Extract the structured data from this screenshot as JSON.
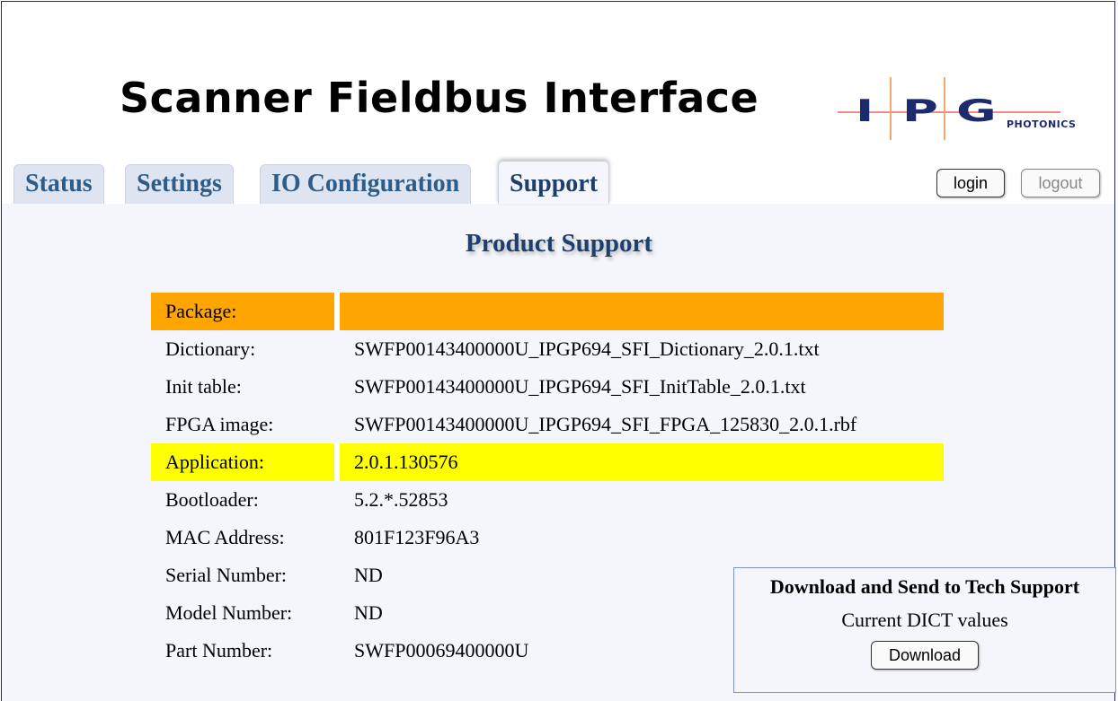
{
  "header": {
    "title": "Scanner Fieldbus Interface",
    "logo": {
      "letters": [
        "I",
        "P",
        "G"
      ],
      "subtext": "PHOTONICS"
    }
  },
  "tabs": [
    {
      "label": "Status"
    },
    {
      "label": "Settings"
    },
    {
      "label": "IO Configuration"
    },
    {
      "label": "Support",
      "active": true
    }
  ],
  "auth": {
    "login_label": "login",
    "logout_label": "logout",
    "logout_disabled": true
  },
  "page": {
    "title": "Product Support"
  },
  "info_rows": [
    {
      "label": "Package:",
      "value": "",
      "highlight": "orange"
    },
    {
      "label": "Dictionary:",
      "value": "SWFP00143400000U_IPGP694_SFI_Dictionary_2.0.1.txt"
    },
    {
      "label": "Init table:",
      "value": "SWFP00143400000U_IPGP694_SFI_InitTable_2.0.1.txt"
    },
    {
      "label": "FPGA image:",
      "value": "SWFP00143400000U_IPGP694_SFI_FPGA_125830_2.0.1.rbf"
    },
    {
      "label": "Application:",
      "value": "2.0.1.130576",
      "highlight": "yellow"
    },
    {
      "label": "Bootloader:",
      "value": "5.2.*.52853"
    },
    {
      "label": "MAC Address:",
      "value": "801F123F96A3"
    },
    {
      "label": "Serial Number:",
      "value": "ND"
    },
    {
      "label": "Model Number:",
      "value": "ND"
    },
    {
      "label": "Part Number:",
      "value": "SWFP00069400000U"
    }
  ],
  "download": {
    "title": "Download and Send to Tech Support",
    "subtitle": "Current DICT values",
    "button_label": "Download"
  },
  "colors": {
    "frame_border": "#1c2a6e",
    "tab_text": "#2c5d8a",
    "title_blue": "#1c3f6e",
    "package_row": "#ffa500",
    "application_row": "#ffff00"
  }
}
